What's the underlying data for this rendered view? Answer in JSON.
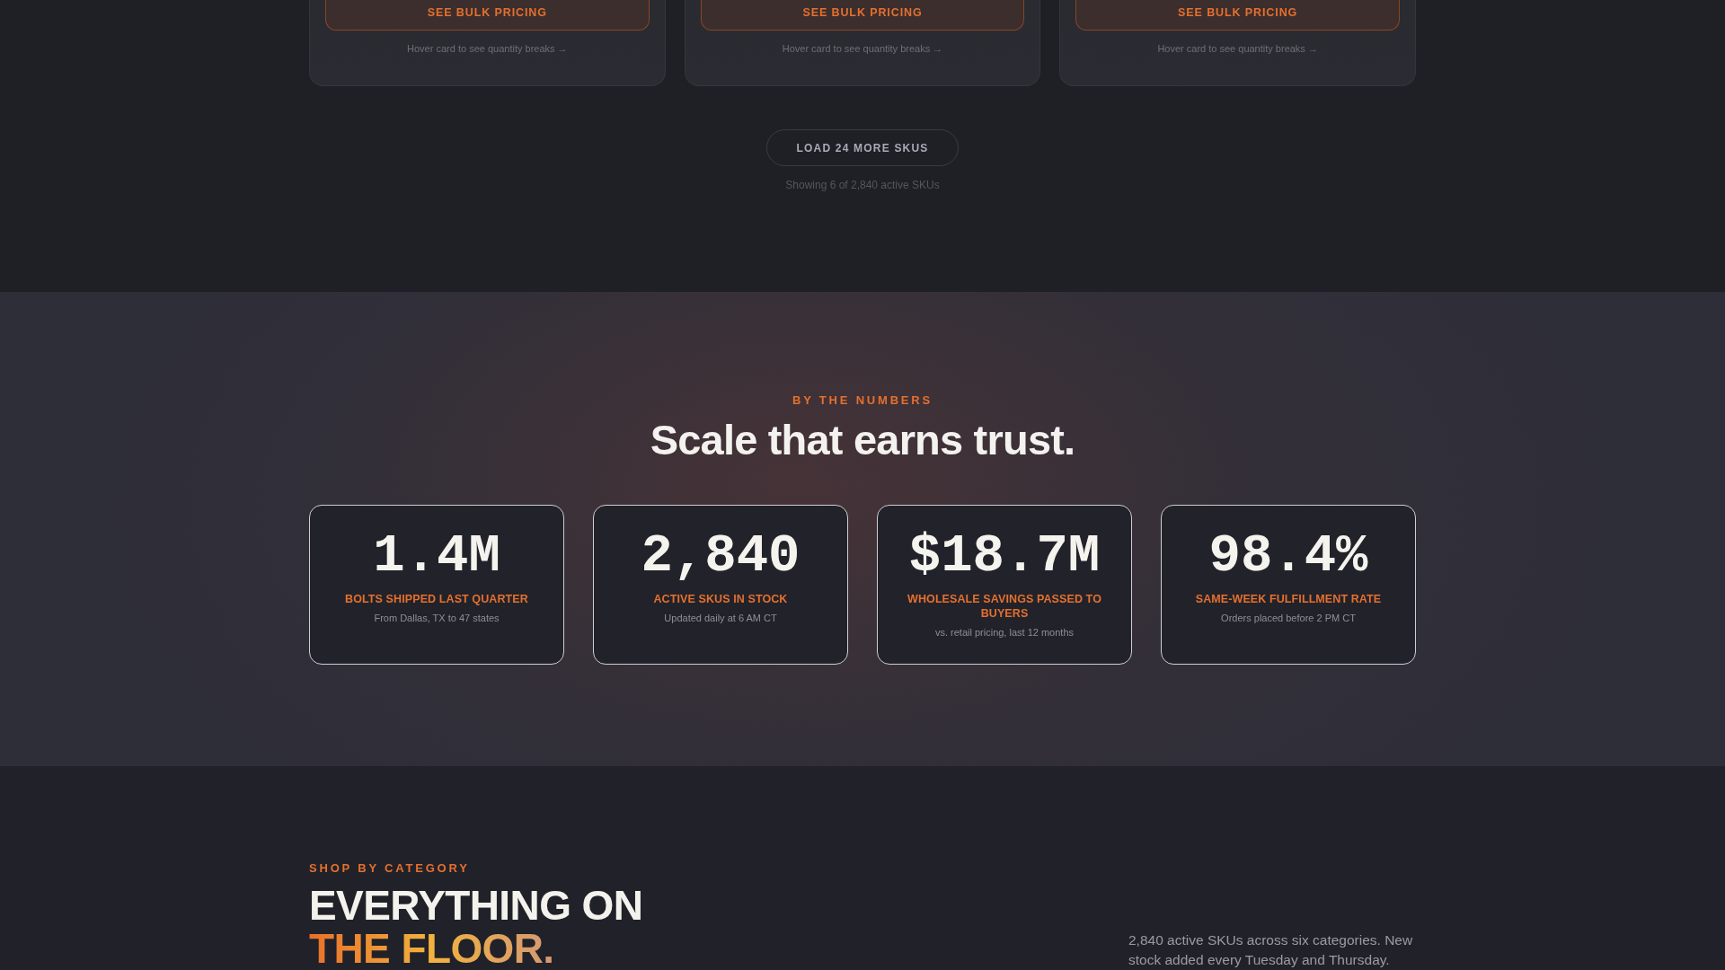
{
  "product_cards": [
    {
      "button": "SEE BULK PRICING",
      "hint": "Hover card to see quantity breaks →"
    },
    {
      "button": "SEE BULK PRICING",
      "hint": "Hover card to see quantity breaks →"
    },
    {
      "button": "SEE BULK PRICING",
      "hint": "Hover card to see quantity breaks →"
    }
  ],
  "load_more": {
    "button": "LOAD 24 MORE SKUS",
    "status": "Showing 6 of 2,840 active SKUs"
  },
  "stats_section": {
    "eyebrow": "BY THE NUMBERS",
    "heading": "Scale that earns trust.",
    "stats": [
      {
        "value": "1.4M",
        "label": "BOLTS SHIPPED LAST QUARTER",
        "note": "From Dallas, TX to 47 states"
      },
      {
        "value": "2,840",
        "label": "ACTIVE SKUS IN STOCK",
        "note": "Updated daily at 6 AM CT"
      },
      {
        "value": "$18.7M",
        "label": "WHOLESALE SAVINGS PASSED TO BUYERS",
        "note": "vs. retail pricing, last 12 months"
      },
      {
        "value": "98.4%",
        "label": "SAME-WEEK FULFILLMENT RATE",
        "note": "Orders placed before 2 PM CT"
      }
    ]
  },
  "category_section": {
    "eyebrow": "SHOP BY CATEGORY",
    "heading": "EVERYTHING ON",
    "heading_highlight": "THE FLOOR.",
    "description": "2,840 active SKUs across six categories. New stock added every Tuesday and Thursday."
  }
}
